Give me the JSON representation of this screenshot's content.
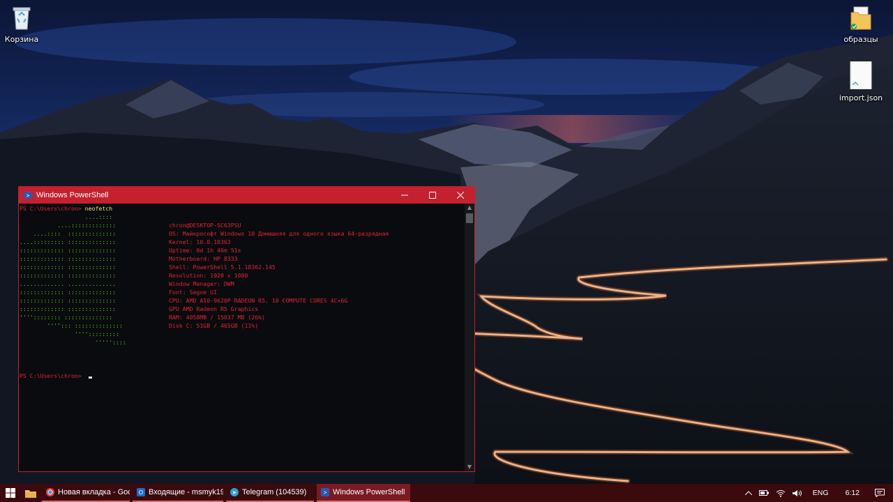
{
  "desktop": {
    "icons": [
      {
        "label": "Корзина",
        "icon": "recycle-bin-icon"
      },
      {
        "label": "образцы",
        "icon": "folder-icon"
      },
      {
        "label": "import.json",
        "icon": "json-file-icon"
      }
    ]
  },
  "powershell": {
    "title": "Windows PowerShell",
    "prompt1": "PS C:\\Users\\chron> ",
    "command1": "neofetch",
    "logo": [
      "                   ....::::",
      "           ....:::::::::::::",
      "    ....::::  ::::::::::::::",
      "....::::::::: ::::::::::::::",
      "::::::::::::: ::::::::::::::",
      "::::::::::::: ::::::::::::::",
      "::::::::::::: ::::::::::::::",
      "::::::::::::: ::::::::::::::",
      "............. ..............",
      "::::::::::::: ::::::::::::::",
      "::::::::::::: ::::::::::::::",
      "::::::::::::: ::::::::::::::",
      "'''':::::::: ::::::::::::::",
      "        ''''::: ::::::::::::::",
      "                '''':::::::::",
      "                      '''''::::"
    ],
    "info": [
      "chron@DESKTOP-SC63PSU",
      "OS: Майкрософт Windows 10 Домашняя для одного языка 64-разрядная",
      "Kernel: 10.0.18363",
      "Uptime: 0d 1h 46m 51s",
      "Motherboard: HP 8333",
      "Shell: PowerShell 5.1.18362.145",
      "Resolution: 1920 x 1080",
      "Window Manager: DWM",
      "Font: Segoe UI",
      "CPU: AMD A10-9620P RADEON R5, 10 COMPUTE CORES 4C+6G",
      "GPU AMD Radeon R5 Graphics",
      "RAM: 4058MB / 15037 MB (26%)",
      "Disk C: 51GB / 465GB (11%)"
    ],
    "prompt2": "PS C:\\Users\\chron> "
  },
  "taskbar": {
    "apps": [
      {
        "label": "Новая вкладка - Goo...",
        "icon": "chrome-icon",
        "active": false
      },
      {
        "label": "Входящие - msmyk19...",
        "icon": "outlook-icon",
        "active": false
      },
      {
        "label": "Telegram (104539)",
        "icon": "telegram-icon",
        "active": false
      },
      {
        "label": "Windows PowerShell",
        "icon": "powershell-icon",
        "active": true
      }
    ],
    "language": "ENG",
    "time": "6:12"
  },
  "colors": {
    "accent": "#c4202d",
    "taskbar": "#3a0a0d",
    "terminal_text": "#e0243a",
    "logo_green": "#5fcf2e",
    "command_yellow": "#e9e26d"
  }
}
